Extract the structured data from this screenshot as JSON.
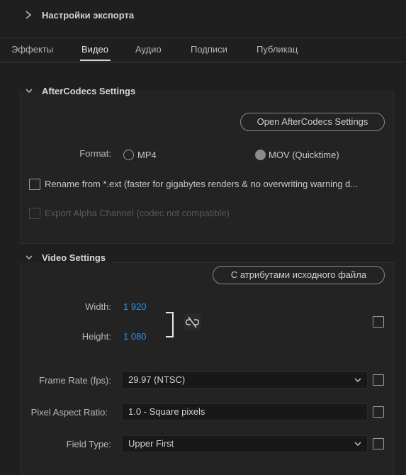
{
  "header": {
    "title": "Настройки экспорта"
  },
  "tabs": [
    {
      "label": "Эффекты"
    },
    {
      "label": "Видео"
    },
    {
      "label": "Аудио"
    },
    {
      "label": "Подписи"
    },
    {
      "label": "Публикац"
    }
  ],
  "aftercodecs": {
    "title": "AfterCodecs Settings",
    "open_button": "Open AfterCodecs Settings",
    "format_label": "Format:",
    "format_options": [
      {
        "label": "MP4",
        "selected": false
      },
      {
        "label": "MOV (Quicktime)",
        "selected": true
      }
    ],
    "rename_label": "Rename from *.ext (faster for gigabytes renders & no overwriting warning d...",
    "alpha_label": "Export Alpha Channel (codec not compatible)"
  },
  "video": {
    "title": "Video Settings",
    "match_source_button": "С атрибутами исходного файла",
    "width_label": "Width:",
    "width_value": "1 920",
    "height_label": "Height:",
    "height_value": "1 080",
    "frame_rate_label": "Frame Rate (fps):",
    "frame_rate_value": "29.97 (NTSC)",
    "par_label": "Pixel Aspect Ratio:",
    "par_value": "1.0 - Square pixels",
    "field_type_label": "Field Type:",
    "field_type_value": "Upper First"
  },
  "colors": {
    "accent_blue": "#2f8fe6",
    "background": "#1f1f1f"
  }
}
